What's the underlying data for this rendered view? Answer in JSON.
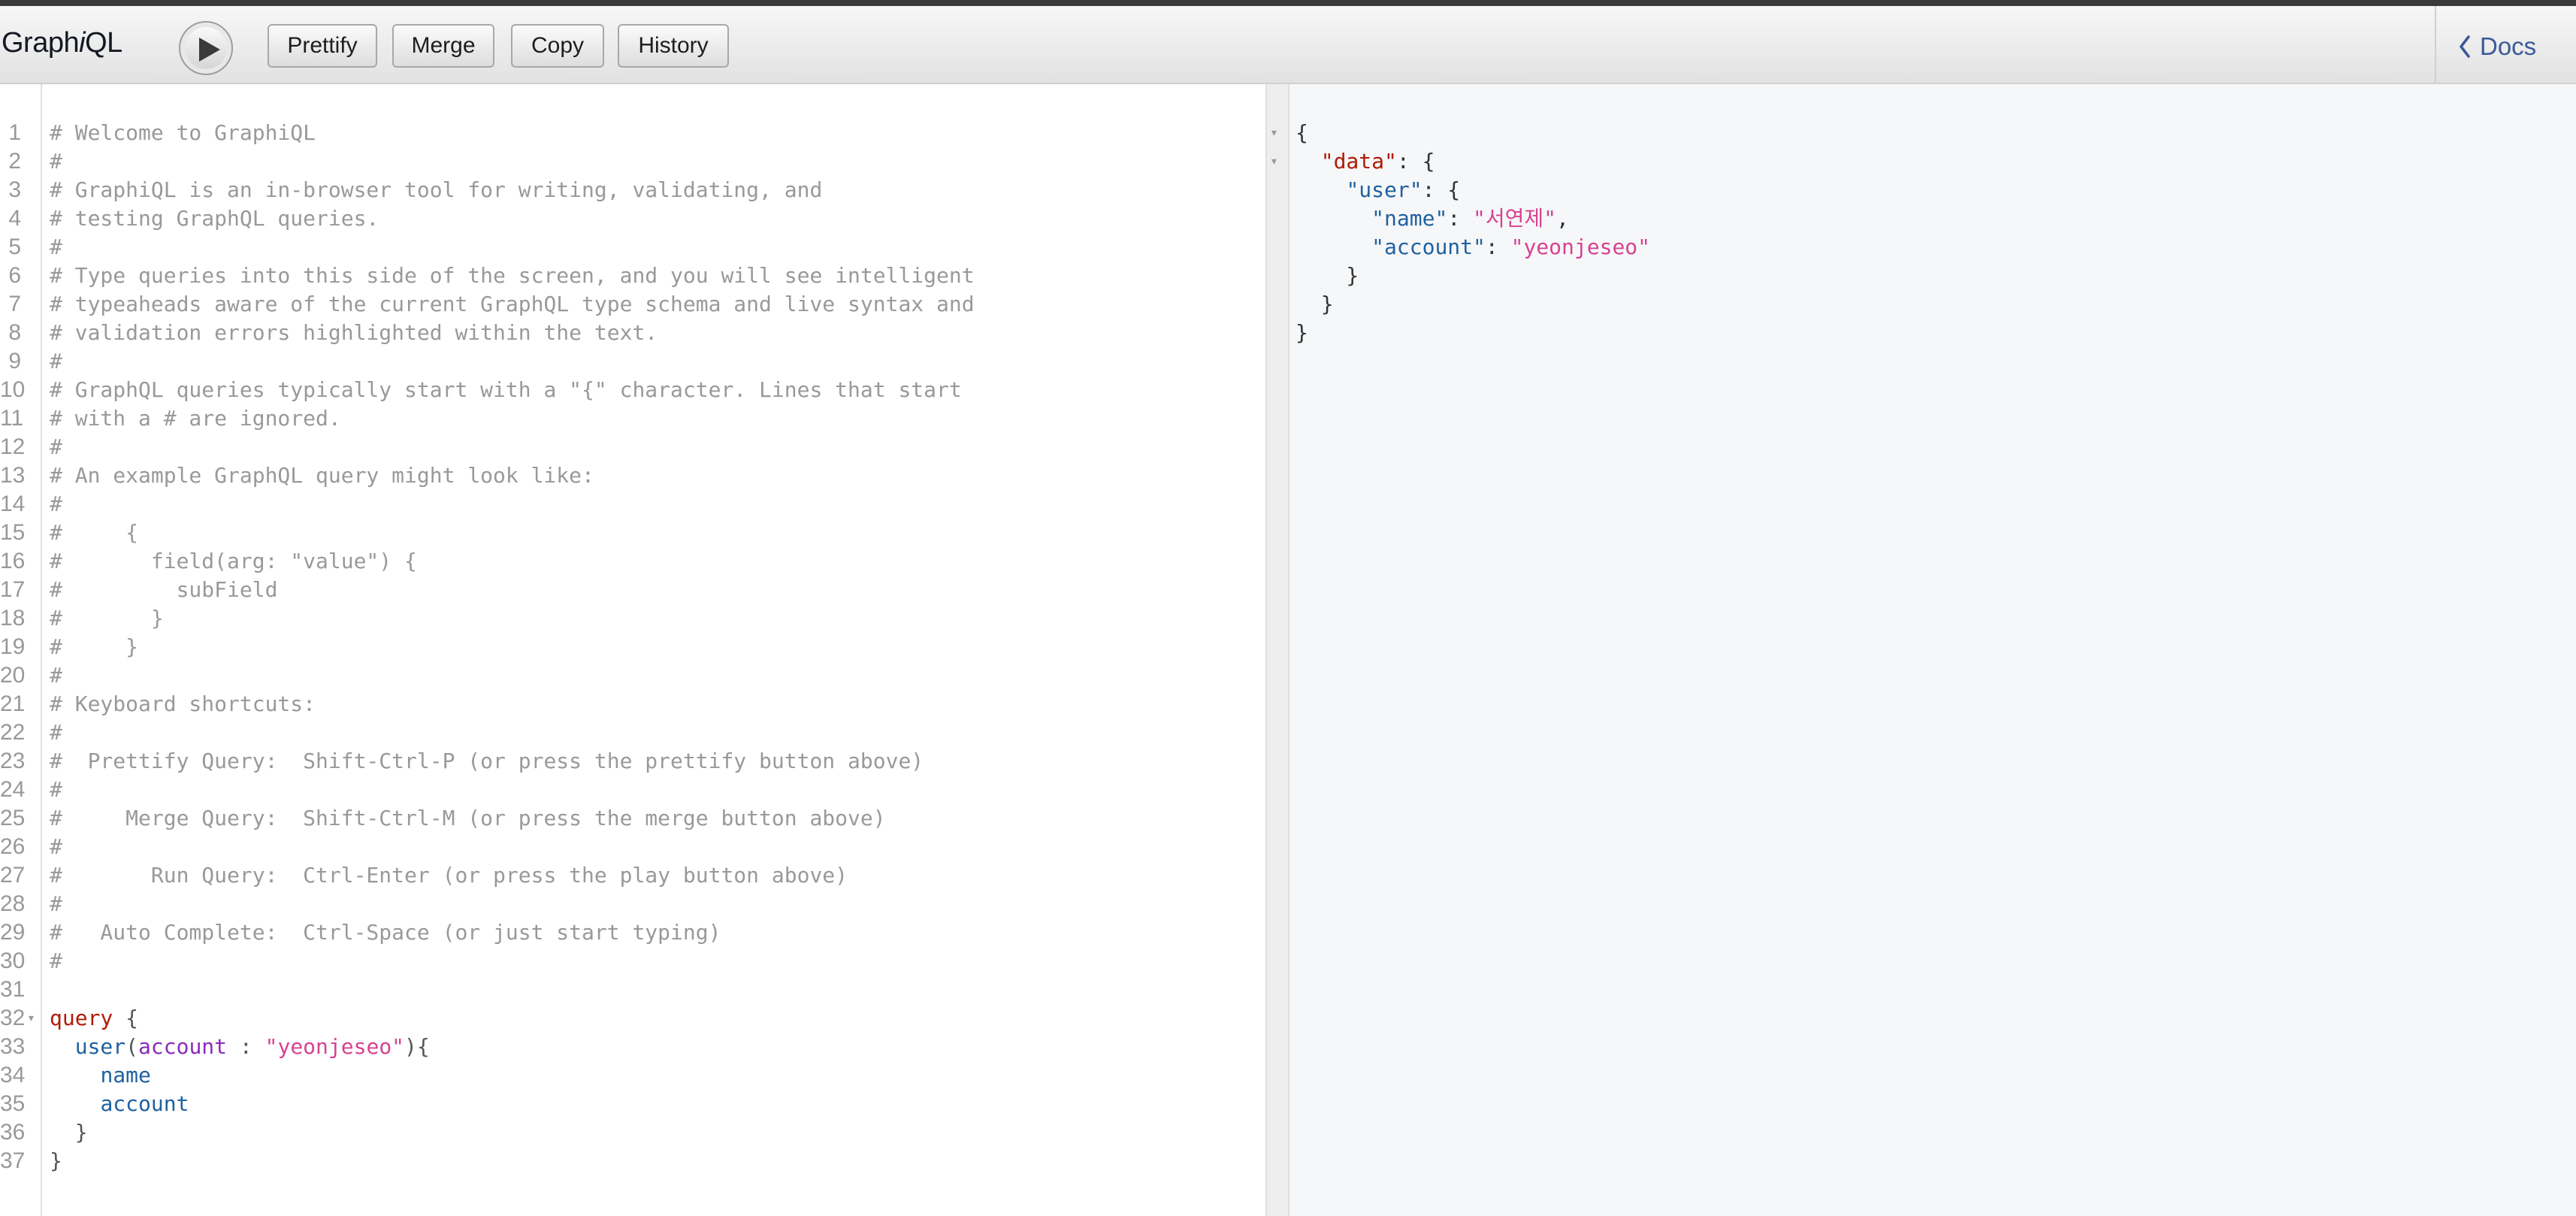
{
  "app": {
    "title_prefix": "Graph",
    "title_i": "i",
    "title_suffix": "QL"
  },
  "toolbar": {
    "prettify_label": "Prettify",
    "merge_label": "Merge",
    "copy_label": "Copy",
    "history_label": "History",
    "docs_label": "Docs"
  },
  "query_editor": {
    "fold_line": 32,
    "lines": [
      [
        {
          "t": "c",
          "v": "# Welcome to GraphiQL"
        }
      ],
      [
        {
          "t": "c",
          "v": "#"
        }
      ],
      [
        {
          "t": "c",
          "v": "# GraphiQL is an in-browser tool for writing, validating, and"
        }
      ],
      [
        {
          "t": "c",
          "v": "# testing GraphQL queries."
        }
      ],
      [
        {
          "t": "c",
          "v": "#"
        }
      ],
      [
        {
          "t": "c",
          "v": "# Type queries into this side of the screen, and you will see intelligent"
        }
      ],
      [
        {
          "t": "c",
          "v": "# typeaheads aware of the current GraphQL type schema and live syntax and"
        }
      ],
      [
        {
          "t": "c",
          "v": "# validation errors highlighted within the text."
        }
      ],
      [
        {
          "t": "c",
          "v": "#"
        }
      ],
      [
        {
          "t": "c",
          "v": "# GraphQL queries typically start with a \"{\" character. Lines that start"
        }
      ],
      [
        {
          "t": "c",
          "v": "# with a # are ignored."
        }
      ],
      [
        {
          "t": "c",
          "v": "#"
        }
      ],
      [
        {
          "t": "c",
          "v": "# An example GraphQL query might look like:"
        }
      ],
      [
        {
          "t": "c",
          "v": "#"
        }
      ],
      [
        {
          "t": "c",
          "v": "#     {"
        }
      ],
      [
        {
          "t": "c",
          "v": "#       field(arg: \"value\") {"
        }
      ],
      [
        {
          "t": "c",
          "v": "#         subField"
        }
      ],
      [
        {
          "t": "c",
          "v": "#       }"
        }
      ],
      [
        {
          "t": "c",
          "v": "#     }"
        }
      ],
      [
        {
          "t": "c",
          "v": "#"
        }
      ],
      [
        {
          "t": "c",
          "v": "# Keyboard shortcuts:"
        }
      ],
      [
        {
          "t": "c",
          "v": "#"
        }
      ],
      [
        {
          "t": "c",
          "v": "#  Prettify Query:  Shift-Ctrl-P (or press the prettify button above)"
        }
      ],
      [
        {
          "t": "c",
          "v": "#"
        }
      ],
      [
        {
          "t": "c",
          "v": "#     Merge Query:  Shift-Ctrl-M (or press the merge button above)"
        }
      ],
      [
        {
          "t": "c",
          "v": "#"
        }
      ],
      [
        {
          "t": "c",
          "v": "#       Run Query:  Ctrl-Enter (or press the play button above)"
        }
      ],
      [
        {
          "t": "c",
          "v": "#"
        }
      ],
      [
        {
          "t": "c",
          "v": "#   Auto Complete:  Ctrl-Space (or just start typing)"
        }
      ],
      [
        {
          "t": "c",
          "v": "#"
        }
      ],
      [],
      [
        {
          "t": "k",
          "v": "query"
        },
        {
          "t": "p",
          "v": " {"
        }
      ],
      [
        {
          "t": "p",
          "v": "  "
        },
        {
          "t": "d",
          "v": "user"
        },
        {
          "t": "p",
          "v": "("
        },
        {
          "t": "a",
          "v": "account"
        },
        {
          "t": "p",
          "v": " : "
        },
        {
          "t": "s",
          "v": "\"yeonjeseo\""
        },
        {
          "t": "p",
          "v": "){"
        }
      ],
      [
        {
          "t": "p",
          "v": "    "
        },
        {
          "t": "d",
          "v": "name"
        }
      ],
      [
        {
          "t": "p",
          "v": "    "
        },
        {
          "t": "d",
          "v": "account"
        }
      ],
      [
        {
          "t": "p",
          "v": "  }"
        }
      ],
      [
        {
          "t": "p",
          "v": "}"
        }
      ]
    ]
  },
  "result_viewer": {
    "lines": [
      {
        "fold": true,
        "parts": [
          {
            "t": "p",
            "v": "{"
          }
        ]
      },
      {
        "fold": true,
        "parts": [
          {
            "t": "p",
            "v": "  "
          },
          {
            "t": "s",
            "v": "\"data\""
          },
          {
            "t": "p",
            "v": ": {"
          }
        ]
      },
      {
        "fold": false,
        "parts": [
          {
            "t": "p",
            "v": "    "
          },
          {
            "t": "k",
            "v": "\"user\""
          },
          {
            "t": "p",
            "v": ": {"
          }
        ]
      },
      {
        "fold": false,
        "parts": [
          {
            "t": "p",
            "v": "      "
          },
          {
            "t": "k",
            "v": "\"name\""
          },
          {
            "t": "p",
            "v": ": "
          },
          {
            "t": "s",
            "v": "\"서연제\""
          },
          {
            "t": "p",
            "v": ","
          }
        ]
      },
      {
        "fold": false,
        "parts": [
          {
            "t": "p",
            "v": "      "
          },
          {
            "t": "k",
            "v": "\"account\""
          },
          {
            "t": "p",
            "v": ": "
          },
          {
            "t": "s",
            "v": "\"yeonjeseo\""
          }
        ]
      },
      {
        "fold": false,
        "parts": [
          {
            "t": "p",
            "v": "    }"
          }
        ]
      },
      {
        "fold": false,
        "parts": [
          {
            "t": "p",
            "v": "  }"
          }
        ]
      },
      {
        "fold": false,
        "parts": [
          {
            "t": "p",
            "v": "}"
          }
        ]
      }
    ]
  },
  "icons": {
    "execute": "play-icon",
    "docs": "chevron-left-icon",
    "fold": "fold-arrow-icon"
  },
  "colors": {
    "comment": "#999999",
    "keyword": "#b11a04",
    "field": "#1f61a0",
    "argument": "#8b2bb9",
    "string": "#d64292",
    "docs_link": "#3b5998"
  }
}
